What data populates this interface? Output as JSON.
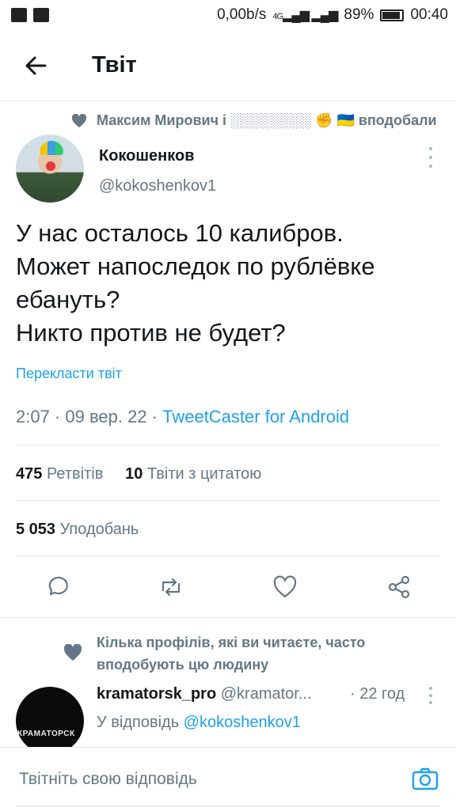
{
  "status_bar": {
    "net_speed": "0,00b/s",
    "network": "4G",
    "battery": "89%",
    "time": "00:40"
  },
  "header": {
    "title": "Твіт"
  },
  "social_context": "Максим Мирович і ░░░░░░░░ ✊ 🇺🇦 вподобали",
  "tweet": {
    "name": "Кокошенков",
    "handle": "@kokoshenkov1",
    "text": "У нас осталось 10 калибров.\nМожет напоследок по рублёвке ебануть?\nНикто против не будет?",
    "translate": "Перекласти твіт",
    "time": "2:07 · 09 вер. 22 · ",
    "source": "TweetCaster for Android"
  },
  "stats": {
    "retweets_count": "475",
    "retweets_label": "Ретвітів",
    "quotes_count": "10",
    "quotes_label": "Твіти з цитатою",
    "likes_count": "5 053",
    "likes_label": "Уподобань"
  },
  "suggestion": "Кілька профілів, які ви читаєте, часто вподобують цю людину",
  "reply": {
    "avatar_text": "КРАМАТОРСК",
    "name": "kramatorsk_pro",
    "handle": "@kramator...",
    "time": "· 22 год",
    "replying_prefix": "У відповідь ",
    "replying_to": "@kokoshenkov1"
  },
  "composer": {
    "placeholder": "Твітніть свою відповідь"
  },
  "colors": {
    "accent": "#1da1f2",
    "secondary": "#657786",
    "text": "#14171a"
  }
}
